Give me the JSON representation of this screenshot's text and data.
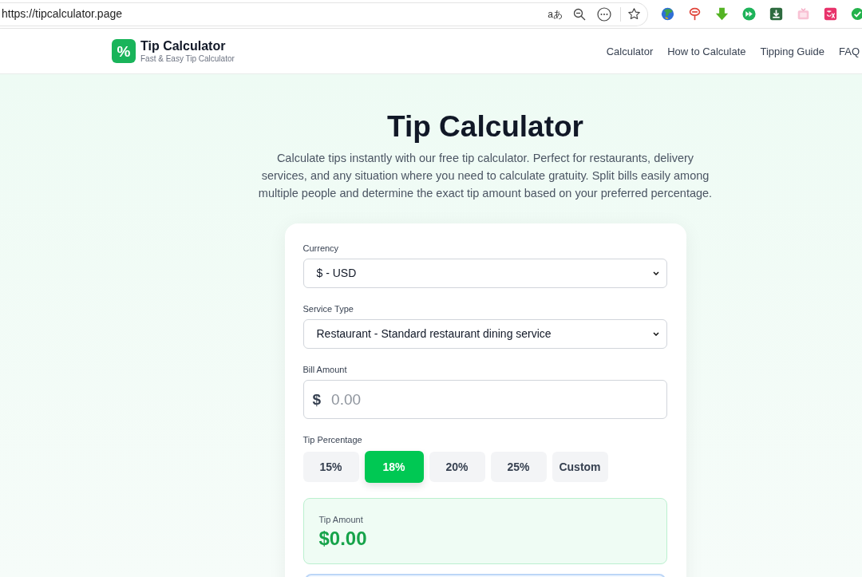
{
  "browser": {
    "url": "https://tipcalculator.page",
    "translate_glyph": "aあ"
  },
  "header": {
    "logo_glyph": "%",
    "title": "Tip Calculator",
    "subtitle": "Fast & Easy Tip Calculator",
    "nav": [
      "Calculator",
      "How to Calculate",
      "Tipping Guide",
      "FAQ"
    ]
  },
  "hero": {
    "title": "Tip Calculator",
    "description": "Calculate tips instantly with our free tip calculator. Perfect for restaurants, delivery services, and any situation where you need to calculate gratuity. Split bills easily among multiple people and determine the exact tip amount based on your preferred percentage."
  },
  "form": {
    "currency": {
      "label": "Currency",
      "value": "$ - USD"
    },
    "service_type": {
      "label": "Service Type",
      "value": "Restaurant - Standard restaurant dining service"
    },
    "bill_amount": {
      "label": "Bill Amount",
      "prefix": "$",
      "placeholder": "0.00"
    },
    "tip_percentage": {
      "label": "Tip Percentage",
      "options": [
        {
          "label": "15%",
          "selected": false
        },
        {
          "label": "18%",
          "selected": true
        },
        {
          "label": "20%",
          "selected": false
        },
        {
          "label": "25%",
          "selected": false
        },
        {
          "label": "Custom",
          "selected": false
        }
      ]
    },
    "result": {
      "label": "Tip Amount",
      "value": "$0.00"
    }
  }
}
